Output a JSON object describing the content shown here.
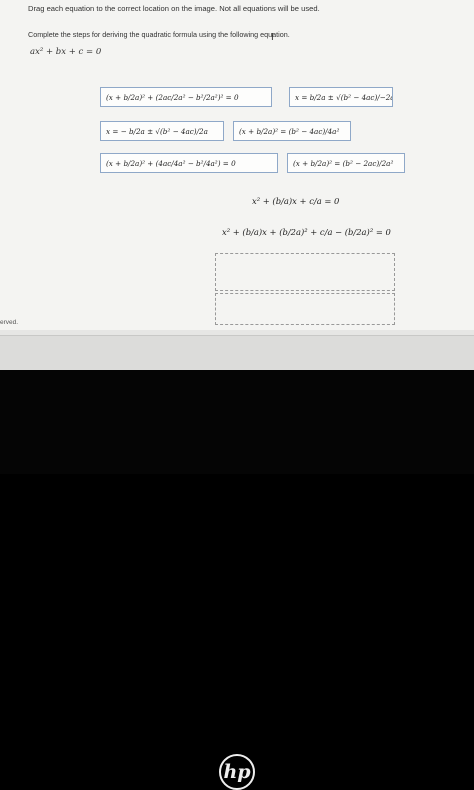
{
  "instruction": "Drag each equation to the correct location on the image. Not all equations will be used.",
  "prompt": "Complete the steps for deriving the quadratic formula using the following equation.",
  "given_equation": "ax² + bx + c = 0",
  "tiles": [
    "(x + b/2a)² + (2ac/2a² − b²/2a²)² = 0",
    "x = b/2a ± √(b² − 4ac)/−2a",
    "x = − b/2a ± √(b² − 4ac)/2a",
    "(x + b/2a)² = (b² − 4ac)/4a²",
    "(x + b/2a)² + (4ac/4a² − b²/4a²) = 0",
    "(x + b/2a)² = (b² − 2ac)/2a²"
  ],
  "steps": [
    "x² + (b/a)x + c/a = 0",
    "x² + (b/a)x + (b/2a)² + c/a − (b/2a)² = 0"
  ],
  "footer_text": "erved.",
  "taskbar_apps": [
    "chrome-icon",
    "photos-icon",
    "outlook-icon",
    "files-icon",
    "play-store-icon"
  ],
  "brand_logo": "hp"
}
